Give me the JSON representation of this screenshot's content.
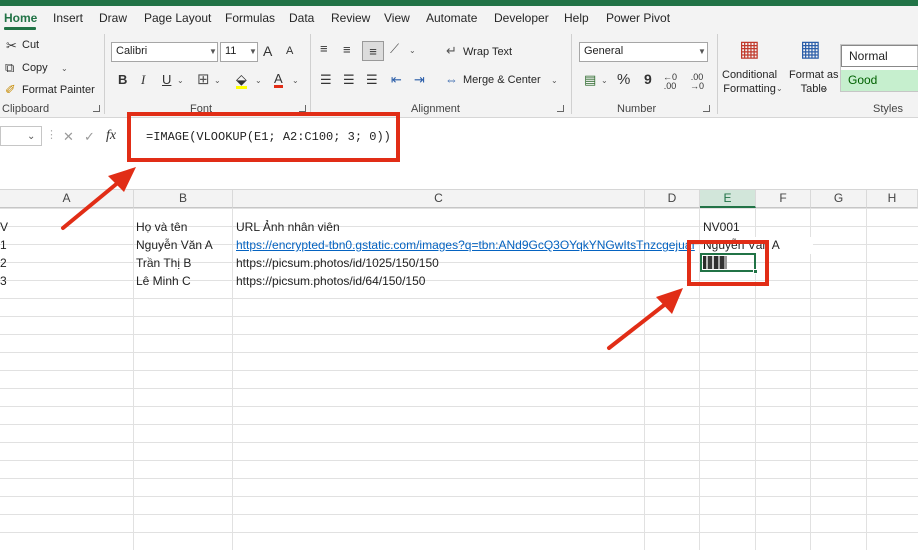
{
  "menu_tabs": [
    "Home",
    "Insert",
    "Draw",
    "Page Layout",
    "Formulas",
    "Data",
    "Review",
    "View",
    "Automate",
    "Developer",
    "Help",
    "Power Pivot"
  ],
  "ribbon": {
    "clipboard": {
      "cut": "Cut",
      "copy": "Copy",
      "format_painter": "Format Painter",
      "label": "Clipboard"
    },
    "font": {
      "name": "Calibri",
      "size": "11",
      "bold": "B",
      "italic": "I",
      "underline": "U",
      "grow": "A",
      "shrink": "A",
      "font_color": "A",
      "label": "Font"
    },
    "alignment": {
      "wrap_text": "Wrap Text",
      "merge_center": "Merge & Center",
      "label": "Alignment"
    },
    "number": {
      "format": "General",
      "percent": "%",
      "comma": "9",
      "label": "Number"
    },
    "styles": {
      "conditional_formatting": "Conditional\nFormatting",
      "format_as_table": "Format as\nTable",
      "normal": "Normal",
      "good": "Good",
      "label": "Styles"
    }
  },
  "formula_bar": {
    "fx": "fx",
    "formula": "=IMAGE(VLOOKUP(E1; A2:C100; 3; 0))"
  },
  "columns": [
    "A",
    "B",
    "C",
    "D",
    "E",
    "F",
    "G",
    "H"
  ],
  "rows": [
    {
      "a": "V",
      "b": "Họ và tên",
      "c": "URL Ảnh nhân viên",
      "e": "NV001"
    },
    {
      "a": "1",
      "b": "Nguyễn Văn A",
      "c": "https://encrypted-tbn0.gstatic.com/images?q=tbn:ANd9GcQ3OYqkYNGwItsTnzcgejuaI",
      "e": "Nguyễn Văn A"
    },
    {
      "a": "2",
      "b": "Trần Thị B",
      "c": "https://picsum.photos/id/1025/150/150",
      "e": ""
    },
    {
      "a": "3",
      "b": "Lê Minh C",
      "c": "https://picsum.photos/id/64/150/150",
      "e": ""
    }
  ],
  "colors": {
    "excel_green": "#217346",
    "annotation_red": "#e12d16",
    "link_blue": "#0563c1"
  }
}
